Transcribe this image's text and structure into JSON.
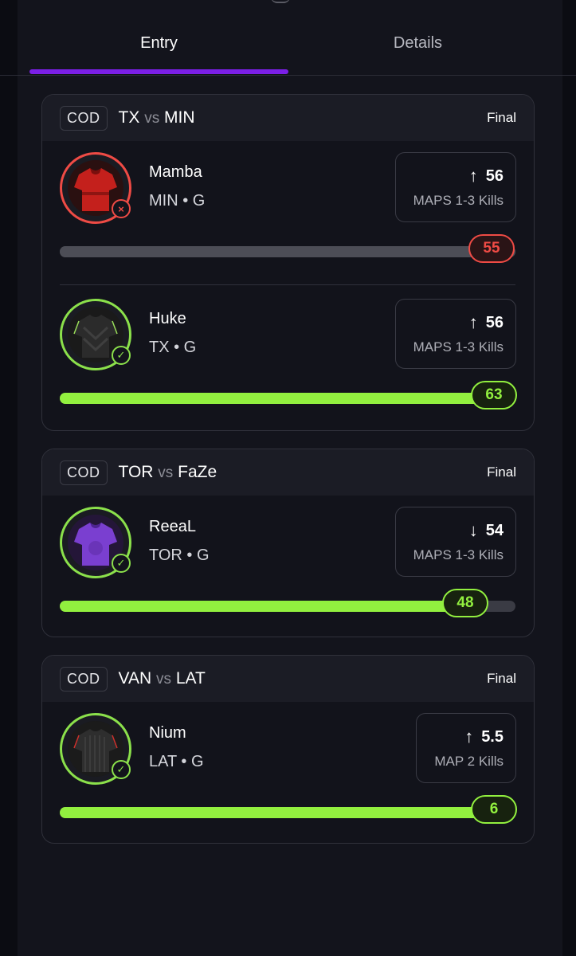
{
  "tabs": [
    {
      "label": "Entry",
      "active": true
    },
    {
      "label": "Details",
      "active": false
    }
  ],
  "colors": {
    "accent": "#7b1fe6",
    "win": "#92f03f",
    "loss": "#ef4b45"
  },
  "cards": [
    {
      "badge": "COD",
      "team_a": "TX",
      "vs": "vs",
      "team_b": "MIN",
      "status": "Final",
      "picks": [
        {
          "name": "Mamba",
          "team": "MIN • G",
          "direction": "↑",
          "line": "56",
          "stat": "MAPS 1-3 Kills",
          "result": "55",
          "outcome": "loss",
          "progress": 1.0,
          "jersey": "red-jersey-icon"
        },
        {
          "name": "Huke",
          "team": "TX • G",
          "direction": "↑",
          "line": "56",
          "stat": "MAPS 1-3 Kills",
          "result": "63",
          "outcome": "win",
          "progress": 1.0,
          "jersey": "black-jersey-icon"
        }
      ]
    },
    {
      "badge": "COD",
      "team_a": "TOR",
      "vs": "vs",
      "team_b": "FaZe",
      "status": "Final",
      "picks": [
        {
          "name": "ReeaL",
          "team": "TOR • G",
          "direction": "↓",
          "line": "54",
          "stat": "MAPS 1-3 Kills",
          "result": "48",
          "outcome": "win",
          "progress": 0.89,
          "jersey": "purple-jersey-icon"
        }
      ]
    },
    {
      "badge": "COD",
      "team_a": "VAN",
      "vs": "vs",
      "team_b": "LAT",
      "status": "Final",
      "picks": [
        {
          "name": "Nium",
          "team": "LAT • G",
          "direction": "↑",
          "line": "5.5",
          "stat": "MAP 2 Kills",
          "result": "6",
          "outcome": "win",
          "progress": 1.0,
          "jersey": "striped-jersey-icon"
        }
      ]
    }
  ]
}
